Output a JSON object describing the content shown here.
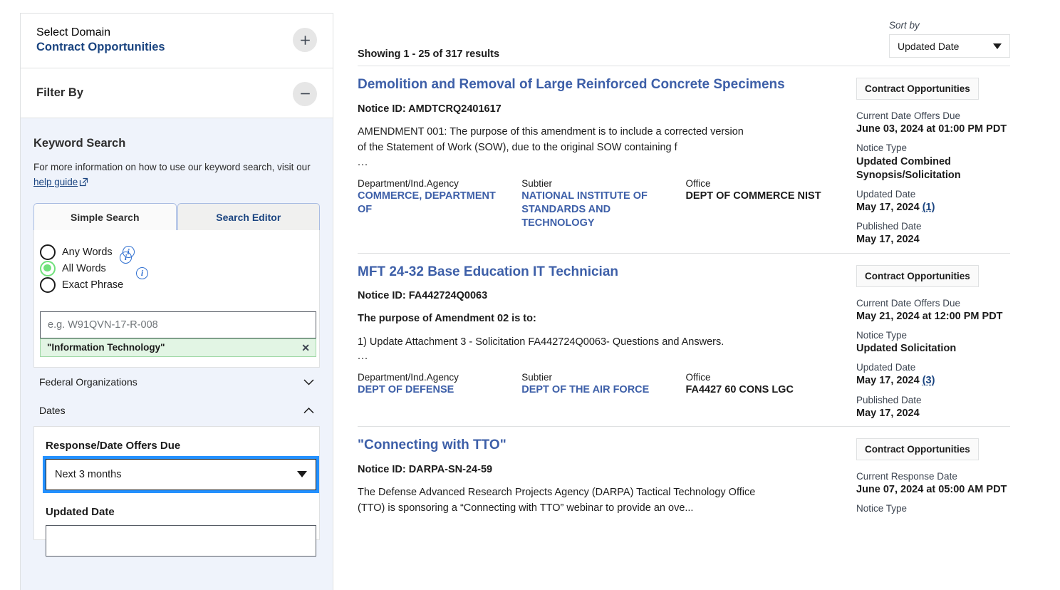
{
  "sidebar": {
    "domain": {
      "label": "Select Domain",
      "value": "Contract Opportunities",
      "expand_icon": "plus-icon"
    },
    "filter_by": {
      "title": "Filter By",
      "collapse_icon": "minus-icon"
    },
    "keyword_search": {
      "title": "Keyword Search",
      "help_text": "For more information on how to use our keyword search, visit our",
      "help_link": "help guide",
      "help_link_icon": "external-link-icon",
      "tabs": [
        {
          "label": "Simple Search",
          "active": true
        },
        {
          "label": "Search Editor",
          "active": false
        }
      ],
      "radios": [
        {
          "label": "Any Words",
          "selected": false,
          "info_icon": "info-icon"
        },
        {
          "label": "All Words",
          "selected": true,
          "info_icon": "info-icon"
        },
        {
          "label": "Exact Phrase",
          "selected": false,
          "info_icon": "info-icon"
        }
      ],
      "input_placeholder": "e.g. W91QVN-17-R-008",
      "input_value": "",
      "chip": {
        "label": "\"Information Technology\"",
        "remove_icon": "close-icon"
      }
    },
    "accordions": [
      {
        "label": "Federal Organizations",
        "icon": "chevron-down-icon",
        "expanded": false
      },
      {
        "label": "Dates",
        "icon": "chevron-up-icon",
        "expanded": true
      }
    ],
    "dates": {
      "response_label": "Response/Date Offers Due",
      "response_value": "Next 3 months",
      "response_caret": "caret-down-icon",
      "updated_label": "Updated Date",
      "updated_value": ""
    },
    "colors": {
      "panel_bg": "#eff3fb",
      "link": "#1a4480",
      "focus_ring": "#2491ff",
      "chip_bg": "#e2f5e4",
      "radio_selected": "#70e17b"
    }
  },
  "main": {
    "sort": {
      "label": "Sort by",
      "value": "Updated Date",
      "caret": "caret-down-icon"
    },
    "showing": "Showing 1 - 25 of 317 results",
    "meta_headers": {
      "dept": "Department/Ind.Agency",
      "subtier": "Subtier",
      "office": "Office"
    },
    "right_labels": {
      "current_date_offers_due": "Current Date Offers Due",
      "current_response_date": "Current Response Date",
      "notice_type": "Notice Type",
      "updated_date": "Updated Date",
      "published_date": "Published Date"
    },
    "results": [
      {
        "title": "Demolition and Removal of Large Reinforced Concrete Specimens",
        "notice_id": "Notice ID: AMDTCRQ2401617",
        "desc_lines": [
          "AMENDMENT 001: The purpose of this amendment is to include a corrected version",
          "of the Statement of Work (SOW), due to the original SOW containing f"
        ],
        "desc_bold": false,
        "sub_desc_lines": [],
        "ellipsis": "...",
        "dept": "COMMERCE, DEPARTMENT OF",
        "subtier": "NATIONAL INSTITUTE OF STANDARDS AND TECHNOLOGY",
        "office": "DEPT OF COMMERCE NIST",
        "badge": "Contract Opportunities",
        "due_label": "Current Date Offers Due",
        "due_value": "June 03, 2024 at 01:00 PM PDT",
        "notice_type_label": "Notice Type",
        "notice_type_value": "Updated Combined Synopsis/Solicitation",
        "updated_label": "Updated Date",
        "updated_value": "May 17, 2024",
        "updated_count": "(1)",
        "published_label": "Published Date",
        "published_value": "May 17, 2024"
      },
      {
        "title": "MFT 24-32 Base Education IT Technician",
        "notice_id": "Notice ID: FA442724Q0063",
        "desc_lines": [
          "The purpose of  Amendment 02 is to:"
        ],
        "desc_bold": true,
        "sub_desc_lines": [
          "1) Update Attachment 3 - Solicitation FA442724Q0063- Questions and Answers."
        ],
        "ellipsis": "...",
        "dept": "DEPT OF DEFENSE",
        "subtier": "DEPT OF THE AIR FORCE",
        "office": "FA4427 60 CONS LGC",
        "badge": "Contract Opportunities",
        "due_label": "Current Date Offers Due",
        "due_value": "May 21, 2024 at 12:00 PM PDT",
        "notice_type_label": "Notice Type",
        "notice_type_value": "Updated Solicitation",
        "updated_label": "Updated Date",
        "updated_value": "May 17, 2024",
        "updated_count": "(3)",
        "published_label": "Published Date",
        "published_value": "May 17, 2024"
      },
      {
        "title": "\"Connecting with TTO\"",
        "notice_id": "Notice ID: DARPA-SN-24-59",
        "desc_lines": [
          "The Defense Advanced Research Projects Agency (DARPA) Tactical Technology Office",
          "(TTO) is sponsoring a “Connecting with TTO” webinar to provide an ove..."
        ],
        "desc_bold": false,
        "sub_desc_lines": [],
        "ellipsis": "",
        "dept": "",
        "subtier": "",
        "office": "",
        "badge": "Contract Opportunities",
        "due_label": "Current Response Date",
        "due_value": "June 07, 2024 at 05:00 AM PDT",
        "notice_type_label": "Notice Type",
        "notice_type_value": "",
        "updated_label": "",
        "updated_value": "",
        "updated_count": "",
        "published_label": "",
        "published_value": ""
      }
    ]
  }
}
